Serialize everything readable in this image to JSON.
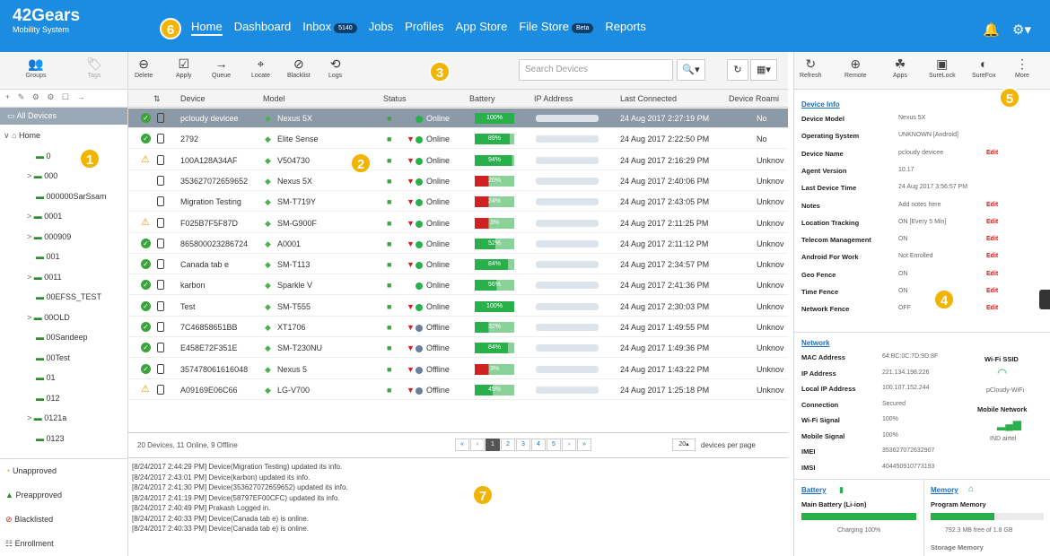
{
  "app": {
    "title": "42Gears",
    "subtitle": "Mobility System"
  },
  "nav": {
    "items": [
      {
        "label": "Home",
        "active": true
      },
      {
        "label": "Dashboard"
      },
      {
        "label": "Inbox",
        "badge": "5140"
      },
      {
        "label": "Jobs"
      },
      {
        "label": "Profiles"
      },
      {
        "label": "App Store"
      },
      {
        "label": "File Store",
        "badge": "Beta"
      },
      {
        "label": "Reports"
      }
    ]
  },
  "callouts": [
    "1",
    "2",
    "3",
    "4",
    "5",
    "6",
    "7"
  ],
  "left_tabs": [
    "Groups",
    "Tags"
  ],
  "toolbar": [
    "Delete",
    "Apply",
    "Queue",
    "Locate",
    "Blacklist",
    "Logs"
  ],
  "search": {
    "placeholder": "Search Devices"
  },
  "sidebar": {
    "all_devices": "All Devices",
    "tree": [
      "Home",
      "0",
      "000",
      "000000SarSsam",
      "0001",
      "000909",
      "001",
      "0011",
      "00EFSS_TEST",
      "00OLD",
      "00Sandeep",
      "00Test",
      "01",
      "012",
      "0121a",
      "0123"
    ],
    "bottom": [
      "Unapproved",
      "Preapproved",
      "Blacklisted",
      "Enrollment"
    ]
  },
  "grid": {
    "headers": [
      "Device",
      "Model",
      "Status",
      "Battery",
      "IP Address",
      "Last Connected",
      "Device Roami"
    ],
    "rows": [
      {
        "icon": "ok",
        "device": "pcloudy devicee",
        "model": "Nexus 5X",
        "status": "Online",
        "battery": "100%",
        "last": "24 Aug 2017 2:27:19 PM",
        "roam": "No",
        "fill": 1.0,
        "dot": "#2ab04a"
      },
      {
        "icon": "ok",
        "device": "2792",
        "model": "Elite Sense",
        "status": "Online",
        "battery": "89%",
        "last": "24 Aug 2017 2:22:50 PM",
        "roam": "No",
        "fill": 0.89,
        "dot": "#2ab04a"
      },
      {
        "icon": "warn",
        "device": "100A128A34AF",
        "model": "V504730",
        "status": "Online",
        "battery": "94%",
        "last": "24 Aug 2017 2:16:29 PM",
        "roam": "Unknov",
        "fill": 0.94,
        "dot": "#2ab04a"
      },
      {
        "icon": "",
        "device": "353627072659652",
        "model": "Nexus 5X",
        "status": "Online",
        "battery": "20%",
        "last": "24 Aug 2017 2:40:06 PM",
        "roam": "Unknov",
        "fill": 0.2,
        "dot": "#2ab04a"
      },
      {
        "icon": "",
        "device": "Migration Testing",
        "model": "SM-T719Y",
        "status": "Online",
        "battery": "24%",
        "last": "24 Aug 2017 2:43:05 PM",
        "roam": "Unknov",
        "fill": 0.24,
        "dot": "#2ab04a"
      },
      {
        "icon": "warn",
        "device": "F025B7F5F87D",
        "model": "SM-G900F",
        "status": "Online",
        "battery": "3%",
        "last": "24 Aug 2017 2:11:25 PM",
        "roam": "Unknov",
        "fill": 0.03,
        "dot": "#2ab04a"
      },
      {
        "icon": "ok",
        "device": "865800023286724",
        "model": "A0001",
        "status": "Online",
        "battery": "52%",
        "last": "24 Aug 2017 2:11:12 PM",
        "roam": "Unknov",
        "fill": 0.52,
        "dot": "#2ab04a"
      },
      {
        "icon": "ok",
        "device": "Canada tab e",
        "model": "SM-T113",
        "status": "Online",
        "battery": "84%",
        "last": "24 Aug 2017 2:34:57 PM",
        "roam": "Unknov",
        "fill": 0.84,
        "dot": "#2ab04a"
      },
      {
        "icon": "ok",
        "device": "karbon",
        "model": "Sparkle V",
        "status": "Online",
        "battery": "56%",
        "last": "24 Aug 2017 2:41:36 PM",
        "roam": "Unknov",
        "fill": 0.56,
        "dot": "#2ab04a"
      },
      {
        "icon": "ok",
        "device": "Test",
        "model": "SM-T555",
        "status": "Online",
        "battery": "100%",
        "last": "24 Aug 2017 2:30:03 PM",
        "roam": "Unknov",
        "fill": 1.0,
        "dot": "#2ab04a"
      },
      {
        "icon": "ok",
        "device": "7C46858651BB",
        "model": "XT1706",
        "status": "Offline",
        "battery": "32%",
        "last": "24 Aug 2017 1:49:55 PM",
        "roam": "Unknov",
        "fill": 0.32,
        "dot": "#6b7f9a"
      },
      {
        "icon": "ok",
        "device": "E458E72F351E",
        "model": "SM-T230NU",
        "status": "Offline",
        "battery": "84%",
        "last": "24 Aug 2017 1:49:36 PM",
        "roam": "Unknov",
        "fill": 0.84,
        "dot": "#6b7f9a"
      },
      {
        "icon": "ok",
        "device": "357478061616048",
        "model": "Nexus 5",
        "status": "Offline",
        "battery": "3%",
        "last": "24 Aug 2017 1:43:22 PM",
        "roam": "Unknov",
        "fill": 0.03,
        "dot": "#6b7f9a"
      },
      {
        "icon": "warn",
        "device": "A09169E06C66",
        "model": "LG-V700",
        "status": "Offline",
        "battery": "45%",
        "last": "24 Aug 2017 1:25:18 PM",
        "roam": "Unknov",
        "fill": 0.45,
        "dot": "#6b7f9a"
      }
    ],
    "footer": "20 Devices, 11 Online, 9 Offline",
    "pages": [
      "«",
      "‹",
      "1",
      "2",
      "3",
      "4",
      "5",
      "›",
      "»"
    ],
    "per_page": "20",
    "per_page_label": "devices per page"
  },
  "log": [
    "[8/24/2017 2:44:29 PM] Device(Migration Testing) updated its info.",
    "[8/24/2017 2:43:01 PM] Device(karbon) updated its info.",
    "[8/24/2017 2:41:30 PM] Device(353627072659652) updated its info.",
    "[8/24/2017 2:41:19 PM] Device(58797EF00CFC) updated its info.",
    "[8/24/2017 2:40:49 PM] Prakash Logged in.",
    "[8/24/2017 2:40:33 PM] Device(Canada tab e) is online.",
    "[8/24/2017 2:40:33 PM] Device(Canada tab e) is online."
  ],
  "right_toolbar": [
    "Refresh",
    "Remote",
    "Apps",
    "SureLock",
    "SureFox",
    "More"
  ],
  "device_info": {
    "title": "Device Info",
    "edit_label": "Edit",
    "rows": [
      {
        "label": "Device Model",
        "value": "Nexus 5X",
        "edit": false
      },
      {
        "label": "Operating System",
        "value": "UNKNOWN [Android]",
        "edit": false
      },
      {
        "label": "Device Name",
        "value": "pcloudy devicee",
        "edit": true
      },
      {
        "label": "Agent Version",
        "value": "10.17",
        "edit": false
      },
      {
        "label": "Last Device Time",
        "value": "24 Aug 2017 3:56:57 PM",
        "edit": false
      },
      {
        "label": "Notes",
        "value": "Add notes here",
        "edit": true
      },
      {
        "label": "Location Tracking",
        "value": "ON [Every 5 Min]",
        "edit": true
      },
      {
        "label": "Telecom Management",
        "value": "ON",
        "edit": true
      },
      {
        "label": "Android For Work",
        "value": "Not Enrolled",
        "edit": true
      },
      {
        "label": "Geo Fence",
        "value": "ON",
        "edit": true
      },
      {
        "label": "Time Fence",
        "value": "ON",
        "edit": true
      },
      {
        "label": "Network Fence",
        "value": "OFF",
        "edit": true
      }
    ]
  },
  "network": {
    "title": "Network",
    "rows": [
      {
        "label": "MAC Address",
        "value": "64:BC:0C:7D:9D:8F"
      },
      {
        "label": "IP Address",
        "value": "221.134.198.226"
      },
      {
        "label": "Local IP Address",
        "value": "100.107.152.244"
      },
      {
        "label": "Connection",
        "value": "Secured"
      },
      {
        "label": "Wi-Fi Signal",
        "value": "100%"
      },
      {
        "label": "Mobile Signal",
        "value": "100%"
      },
      {
        "label": "IMEI",
        "value": "353627072632907"
      },
      {
        "label": "IMSI",
        "value": "404450910773193"
      }
    ],
    "wifi_ssid_label": "Wi-Fi SSID",
    "wifi_ssid": "pCloudy-WiFi",
    "mobile_label": "Mobile Network",
    "mobile_value": "IND airtel"
  },
  "battery": {
    "title": "Battery",
    "main_label": "Main Battery (Li-ion)",
    "status": "Charging 100%",
    "level": 1.0
  },
  "memory": {
    "title": "Memory",
    "program_label": "Program Memory",
    "program_value": "792.3 MB free of 1.8 GB",
    "storage_label": "Storage Memory",
    "level": 0.56
  }
}
